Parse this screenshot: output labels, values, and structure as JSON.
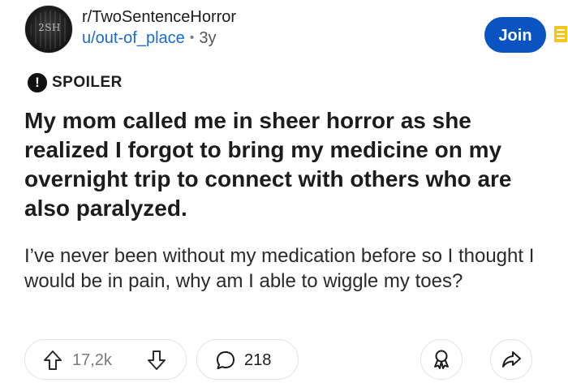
{
  "header": {
    "avatar_text": "2SH",
    "subreddit": "r/TwoSentenceHorror",
    "author": "u/out-of_place",
    "separator": "•",
    "age": "3y",
    "join_label": "Join"
  },
  "post": {
    "spoiler_icon": "!",
    "spoiler_label": "SPOILER",
    "title": "My mom called me in sheer horror as she realized I forgot to bring my medicine on my overnight trip to connect with others who are also paralyzed.",
    "body": "I’ve never been without my medication before so I thought I would be in pain, why am I able to wiggle my toes?"
  },
  "actions": {
    "upvotes": "17,2k",
    "comments": "218"
  },
  "icons": {
    "menu": "archive-box-icon",
    "upvote": "arrow-up-icon",
    "downvote": "arrow-down-icon",
    "comment": "speech-bubble-icon",
    "award": "award-ribbon-icon",
    "share": "share-arrow-icon"
  },
  "colors": {
    "join_button": "#0a54c2",
    "author_link": "#1a6ad6",
    "menu_icon": "#f5c518",
    "text": "#1c1c1c"
  }
}
